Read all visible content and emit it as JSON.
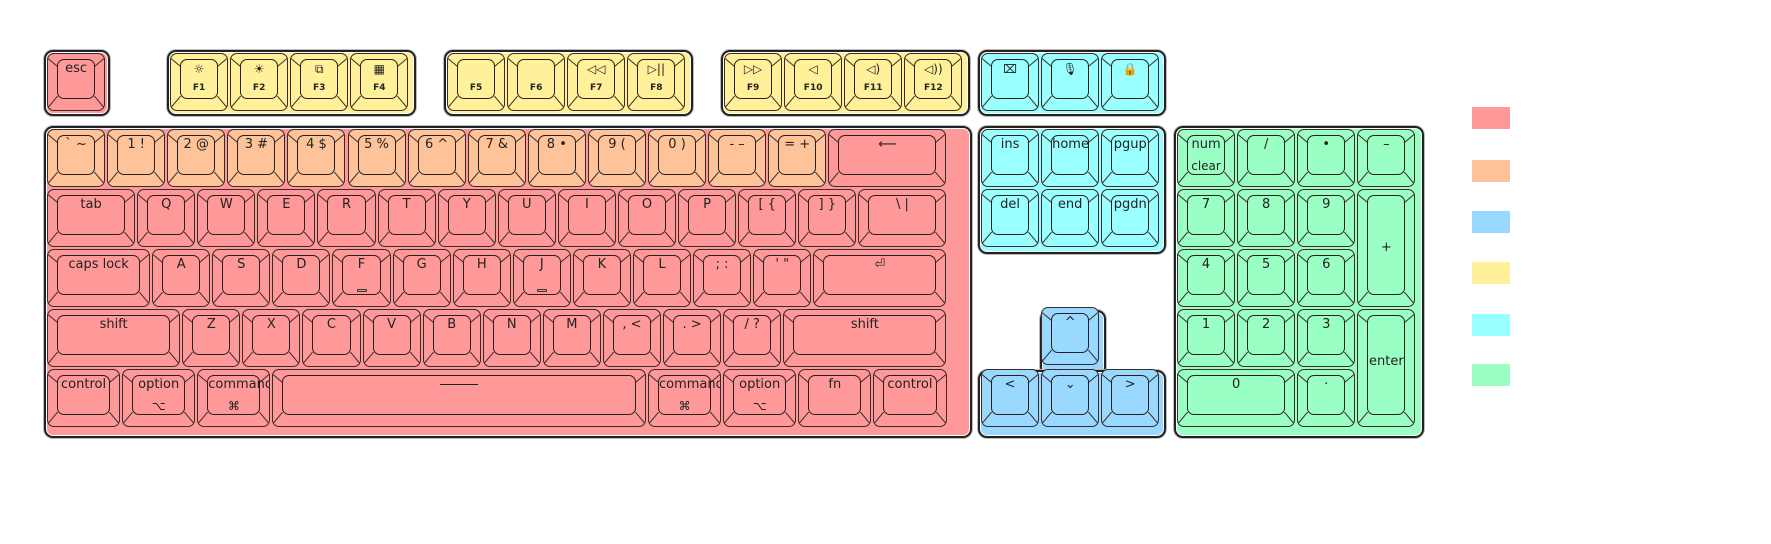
{
  "colors": {
    "modifier": "#ff9999",
    "number_row": "#ffc399",
    "arrows": "#99d8ff",
    "function_row": "#fff199",
    "navigation": "#99ffff",
    "numpad": "#99ffc3"
  },
  "legend": [
    {
      "name": "legend-swatch-modifier",
      "color_key": "modifier"
    },
    {
      "name": "legend-swatch-number-row",
      "color_key": "number_row"
    },
    {
      "name": "legend-swatch-arrows",
      "color_key": "arrows"
    },
    {
      "name": "legend-swatch-function-row",
      "color_key": "function_row"
    },
    {
      "name": "legend-swatch-navigation",
      "color_key": "navigation"
    },
    {
      "name": "legend-swatch-numpad",
      "color_key": "numpad"
    }
  ],
  "keys": {
    "esc": {
      "label": "esc"
    },
    "f1": {
      "icon": "☼",
      "fn": "F1",
      "icon_name": "brightness-down-icon"
    },
    "f2": {
      "icon": "☀",
      "fn": "F2",
      "icon_name": "brightness-up-icon"
    },
    "f3": {
      "icon": "⧉",
      "fn": "F3",
      "icon_name": "mission-control-icon"
    },
    "f4": {
      "icon": "▦",
      "fn": "F4",
      "icon_name": "launchpad-icon"
    },
    "f5": {
      "icon": "",
      "fn": "F5",
      "icon_name": "blank-icon"
    },
    "f6": {
      "icon": "",
      "fn": "F6",
      "icon_name": "blank-icon"
    },
    "f7": {
      "icon": "◁◁",
      "fn": "F7",
      "icon_name": "rewind-icon"
    },
    "f8": {
      "icon": "▷||",
      "fn": "F8",
      "icon_name": "play-pause-icon"
    },
    "f9": {
      "icon": "▷▷",
      "fn": "F9",
      "icon_name": "fast-forward-icon"
    },
    "f10": {
      "icon": "◁",
      "fn": "F10",
      "icon_name": "mute-icon"
    },
    "f11": {
      "icon": "◁)",
      "fn": "F11",
      "icon_name": "volume-down-icon"
    },
    "f12": {
      "icon": "◁))",
      "fn": "F12",
      "icon_name": "volume-up-icon"
    },
    "screenshot": {
      "icon": "⌧",
      "icon_name": "screenshot-icon"
    },
    "mic": {
      "icon": "🎙",
      "icon_name": "microphone-icon"
    },
    "lock": {
      "icon": "🔒",
      "icon_name": "lock-icon"
    },
    "grave": {
      "label": "` ~"
    },
    "n1": {
      "label": "1 !"
    },
    "n2": {
      "label": "2 @"
    },
    "n3": {
      "label": "3 #"
    },
    "n4": {
      "label": "4 $"
    },
    "n5": {
      "label": "5 %"
    },
    "n6": {
      "label": "6 ^"
    },
    "n7": {
      "label": "7 &"
    },
    "n8": {
      "label": "8 •"
    },
    "n9": {
      "label": "9 ("
    },
    "n0": {
      "label": "0 )"
    },
    "minus": {
      "label": "- –"
    },
    "equal": {
      "label": "= +"
    },
    "backspace": {
      "label": "⟵"
    },
    "tab": {
      "label": "tab"
    },
    "q": {
      "label": "Q"
    },
    "w": {
      "label": "W"
    },
    "e": {
      "label": "E"
    },
    "r": {
      "label": "R"
    },
    "t": {
      "label": "T"
    },
    "y": {
      "label": "Y"
    },
    "u": {
      "label": "U"
    },
    "i": {
      "label": "I"
    },
    "o": {
      "label": "O"
    },
    "p": {
      "label": "P"
    },
    "lbracket": {
      "label": "[ {"
    },
    "rbracket": {
      "label": "] }"
    },
    "backslash": {
      "label": "\\ |"
    },
    "caps": {
      "label": "caps lock"
    },
    "a": {
      "label": "A"
    },
    "s": {
      "label": "S"
    },
    "d": {
      "label": "D"
    },
    "f": {
      "label": "F"
    },
    "g": {
      "label": "G"
    },
    "h": {
      "label": "H"
    },
    "j": {
      "label": "J"
    },
    "k": {
      "label": "K"
    },
    "l": {
      "label": "L"
    },
    "semicolon": {
      "label": "; :"
    },
    "quote": {
      "label": "' \""
    },
    "enter": {
      "label": "⏎"
    },
    "lshift": {
      "label": "shift"
    },
    "z": {
      "label": "Z"
    },
    "x": {
      "label": "X"
    },
    "c": {
      "label": "C"
    },
    "v": {
      "label": "V"
    },
    "b": {
      "label": "B"
    },
    "n": {
      "label": "N"
    },
    "m": {
      "label": "M"
    },
    "comma": {
      "label": ", <"
    },
    "period": {
      "label": ". >"
    },
    "slash": {
      "label": "/ ?"
    },
    "rshift": {
      "label": "shift"
    },
    "lcontrol": {
      "label": "control"
    },
    "loption": {
      "label": "option",
      "sub": "⌥"
    },
    "lcommand": {
      "label": "command",
      "sub": "⌘"
    },
    "space": {
      "label": ""
    },
    "rcommand": {
      "label": "command",
      "sub": "⌘"
    },
    "roption": {
      "label": "option",
      "sub": "⌥"
    },
    "fnkey": {
      "label": "fn"
    },
    "rcontrol": {
      "label": "control"
    },
    "ins": {
      "label": "ins"
    },
    "home": {
      "label": "home"
    },
    "pgup": {
      "label": "pgup"
    },
    "del": {
      "label": "del"
    },
    "end": {
      "label": "end"
    },
    "pgdn": {
      "label": "pgdn"
    },
    "up": {
      "label": "^"
    },
    "left": {
      "label": "<"
    },
    "down": {
      "label": "⌄"
    },
    "right": {
      "label": ">"
    },
    "numclear": {
      "label": "num",
      "sub": "clear"
    },
    "kpslash": {
      "label": "/"
    },
    "kpstar": {
      "label": "•"
    },
    "kpminus": {
      "label": "–"
    },
    "kp7": {
      "label": "7"
    },
    "kp8": {
      "label": "8"
    },
    "kp9": {
      "label": "9"
    },
    "kpplus": {
      "label": "+"
    },
    "kp4": {
      "label": "4"
    },
    "kp5": {
      "label": "5"
    },
    "kp6": {
      "label": "6"
    },
    "kp1": {
      "label": "1"
    },
    "kp2": {
      "label": "2"
    },
    "kp3": {
      "label": "3"
    },
    "kpenter": {
      "label": "enter"
    },
    "kp0": {
      "label": "0"
    },
    "kpdot": {
      "label": "·"
    }
  }
}
